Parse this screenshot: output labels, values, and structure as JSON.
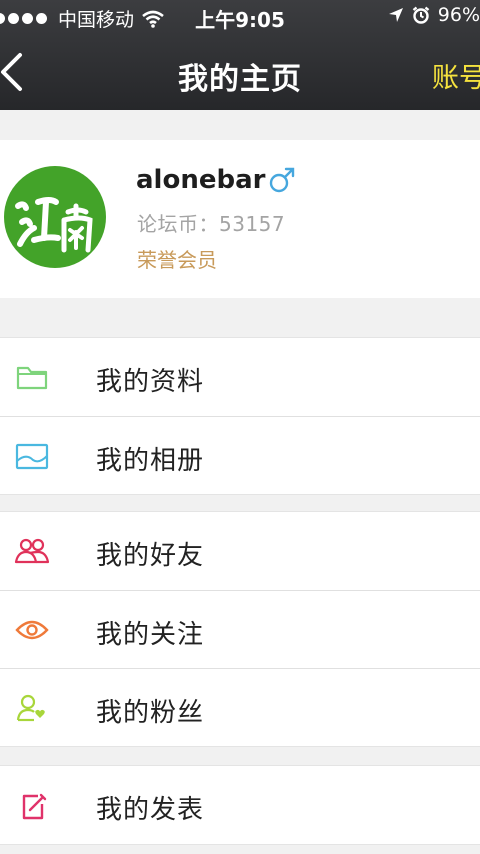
{
  "status_bar": {
    "carrier": "中国移动",
    "time": "上午9:05",
    "battery": "96%"
  },
  "nav": {
    "title": "我的主页",
    "account_label": "账号"
  },
  "profile": {
    "username": "alonebar",
    "coins_label": "论坛币：",
    "coins_value": "53157",
    "rank": "荣誉会员",
    "gender_icon": "male-icon",
    "avatar_text": "江南",
    "avatar_color": "#43a329"
  },
  "groups": [
    {
      "items": [
        {
          "label": "我的资料",
          "icon": "folder-icon",
          "color": "#7ed47c"
        },
        {
          "label": "我的相册",
          "icon": "image-icon",
          "color": "#4ab8e0"
        }
      ]
    },
    {
      "items": [
        {
          "label": "我的好友",
          "icon": "friends-icon",
          "color": "#e0325a"
        },
        {
          "label": "我的关注",
          "icon": "eye-icon",
          "color": "#ef7a3a"
        },
        {
          "label": "我的粉丝",
          "icon": "follower-icon",
          "color": "#a8d63a"
        }
      ]
    },
    {
      "items": [
        {
          "label": "我的发表",
          "icon": "edit-icon",
          "color": "#e0326a"
        }
      ]
    }
  ]
}
